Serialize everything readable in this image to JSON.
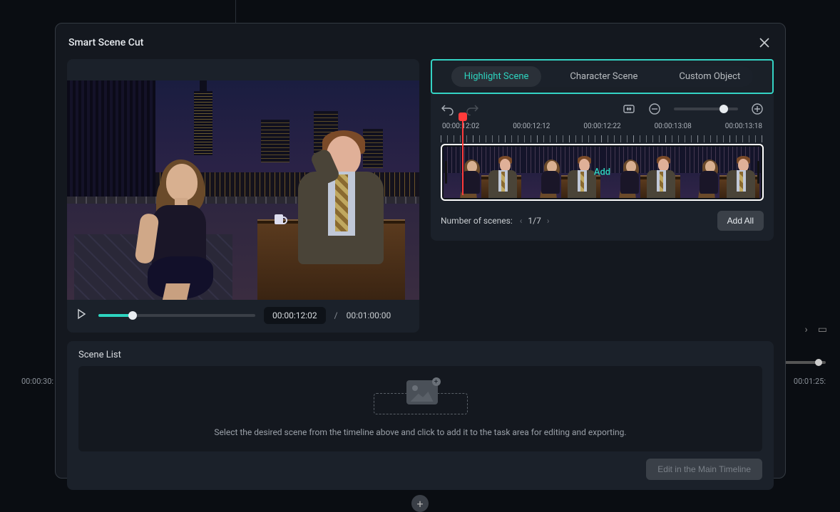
{
  "modal": {
    "title": "Smart Scene Cut",
    "tabs": {
      "highlight": "Highlight Scene",
      "character": "Character Scene",
      "custom": "Custom Object",
      "active": "highlight"
    },
    "preview": {
      "current_time": "00:00:12:02",
      "separator": "/",
      "total_time": "00:01:00:00",
      "seek_percent": 22
    },
    "timeline": {
      "labels": [
        "00:00:12:02",
        "00:00:12:12",
        "00:00:12:22",
        "00:00:13:08",
        "00:00:13:18"
      ],
      "add_label": "Add",
      "scenes_label": "Number of scenes:",
      "pager": "1/7",
      "add_all_label": "Add All"
    },
    "scene_list": {
      "title": "Scene List",
      "empty_text": "Select the desired scene from the timeline above and click to add it to the task area for editing and exporting.",
      "edit_main_label": "Edit in the Main Timeline"
    }
  },
  "background": {
    "left_time": "00:00:30:",
    "right_time": "00:01:25:"
  }
}
